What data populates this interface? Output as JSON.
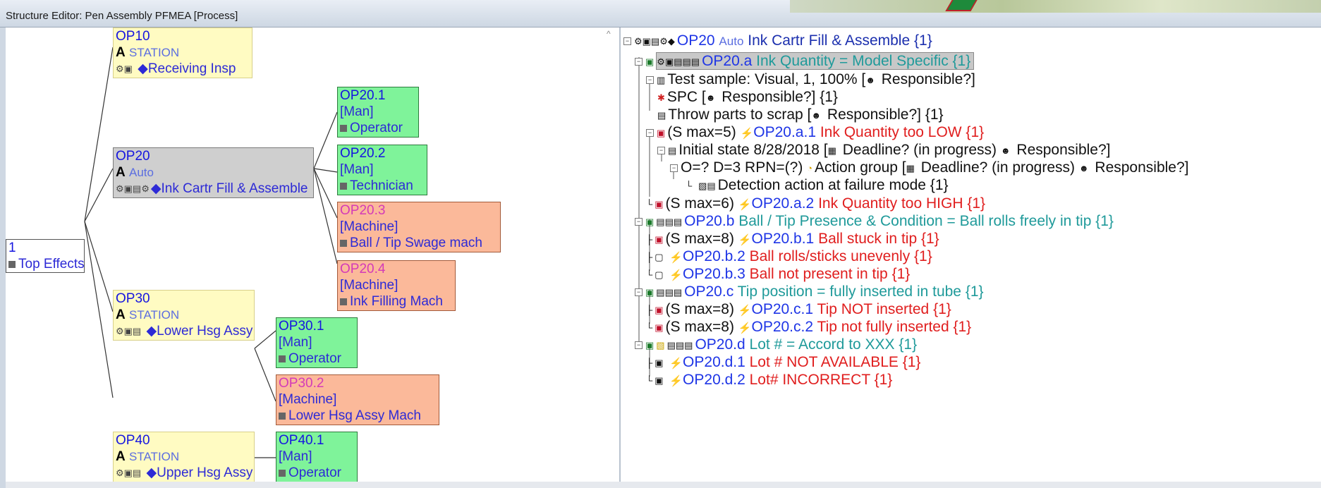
{
  "window": {
    "title": "Structure Editor: Pen Assembly PFMEA [Process]"
  },
  "left_tree": {
    "root": {
      "id": "1",
      "label": "Top Effects"
    },
    "op10": {
      "id": "OP10",
      "kind": "STATION",
      "name": "Receiving Insp"
    },
    "op20": {
      "id": "OP20",
      "kind": "Auto",
      "name": "Ink Cartr Fill & Assemble"
    },
    "op30": {
      "id": "OP30",
      "kind": "STATION",
      "name": "Lower Hsg Assy"
    },
    "op40": {
      "id": "OP40",
      "kind": "STATION",
      "name": "Upper Hsg Assy"
    },
    "work_elements": [
      {
        "id": "OP20.1",
        "type": "[Man]",
        "name": "Operator"
      },
      {
        "id": "OP20.2",
        "type": "[Man]",
        "name": "Technician"
      },
      {
        "id": "OP20.3",
        "type": "[Machine]",
        "name": "Ball / Tip Swage mach"
      },
      {
        "id": "OP20.4",
        "type": "[Machine]",
        "name": "Ink Filling Mach"
      },
      {
        "id": "OP30.1",
        "type": "[Man]",
        "name": "Operator"
      },
      {
        "id": "OP30.2",
        "type": "[Machine]",
        "name": "Lower Hsg Assy Mach"
      },
      {
        "id": "OP40.1",
        "type": "[Man]",
        "name": "Operator"
      }
    ],
    "bold_a": "A"
  },
  "right_tree": {
    "root": {
      "id": "OP20",
      "kind": "Auto",
      "name": "Ink Cartr Fill & Assemble",
      "count": "{1}"
    },
    "rows": [
      {
        "pre": "",
        "id": "OP20.a",
        "text": "Ink Quantity = Model Specific {1}"
      },
      {
        "pre": "Test sample: Visual, 1, 100% [",
        "resp": "Responsible?]"
      },
      {
        "pre": "SPC [",
        "resp": "Responsible?] {1}"
      },
      {
        "pre": "Throw parts to scrap [",
        "resp": "Responsible?] {1}"
      },
      {
        "pre": "(S max=5) ",
        "id": "OP20.a.1",
        "text": "Ink Quantity too LOW {1}"
      },
      {
        "pre": "Initial state 8/28/2018 [",
        "deadline": "Deadline? (in progress)",
        "resp": "Responsible?]"
      },
      {
        "pre": "O=? D=3 RPN=(?) ",
        "action": "Action group [",
        "deadline": "Deadline? (in progress)",
        "resp": "Responsible?]"
      },
      {
        "pre": "Detection action at failure mode {1}"
      },
      {
        "pre": "(S max=6) ",
        "id": "OP20.a.2",
        "text": "Ink Quantity too HIGH {1}"
      },
      {
        "pre": "",
        "id": "OP20.b",
        "text": "Ball / Tip Presence & Condition = Ball rolls freely in tip {1}"
      },
      {
        "pre": "(S max=8) ",
        "id": "OP20.b.1",
        "text": "Ball stuck in tip {1}"
      },
      {
        "pre": "",
        "id": "OP20.b.2",
        "text": "Ball rolls/sticks unevenly {1}"
      },
      {
        "pre": "",
        "id": "OP20.b.3",
        "text": "Ball not present in tip {1}"
      },
      {
        "pre": "",
        "id": "OP20.c",
        "text": "Tip position = fully inserted in tube {1}"
      },
      {
        "pre": "(S max=8) ",
        "id": "OP20.c.1",
        "text": "Tip NOT inserted {1}"
      },
      {
        "pre": "(S max=8) ",
        "id": "OP20.c.2",
        "text": "Tip not fully inserted {1}"
      },
      {
        "pre": "",
        "id": "OP20.d",
        "text": "Lot # = Accord to XXX {1}"
      },
      {
        "pre": "",
        "id": "OP20.d.1",
        "text": "Lot # NOT AVAILABLE {1}"
      },
      {
        "pre": "",
        "id": "OP20.d.2",
        "text": "Lot# INCORRECT {1}"
      }
    ]
  },
  "colors": {
    "station_bg": "#fffbc2",
    "man_bg": "#7ff39a",
    "machine_bg": "#fbb99a",
    "selected_bg": "#cfcfcf",
    "failure": "#e01e1e",
    "function": "#1f9a9a",
    "id_blue": "#1e35e6"
  }
}
